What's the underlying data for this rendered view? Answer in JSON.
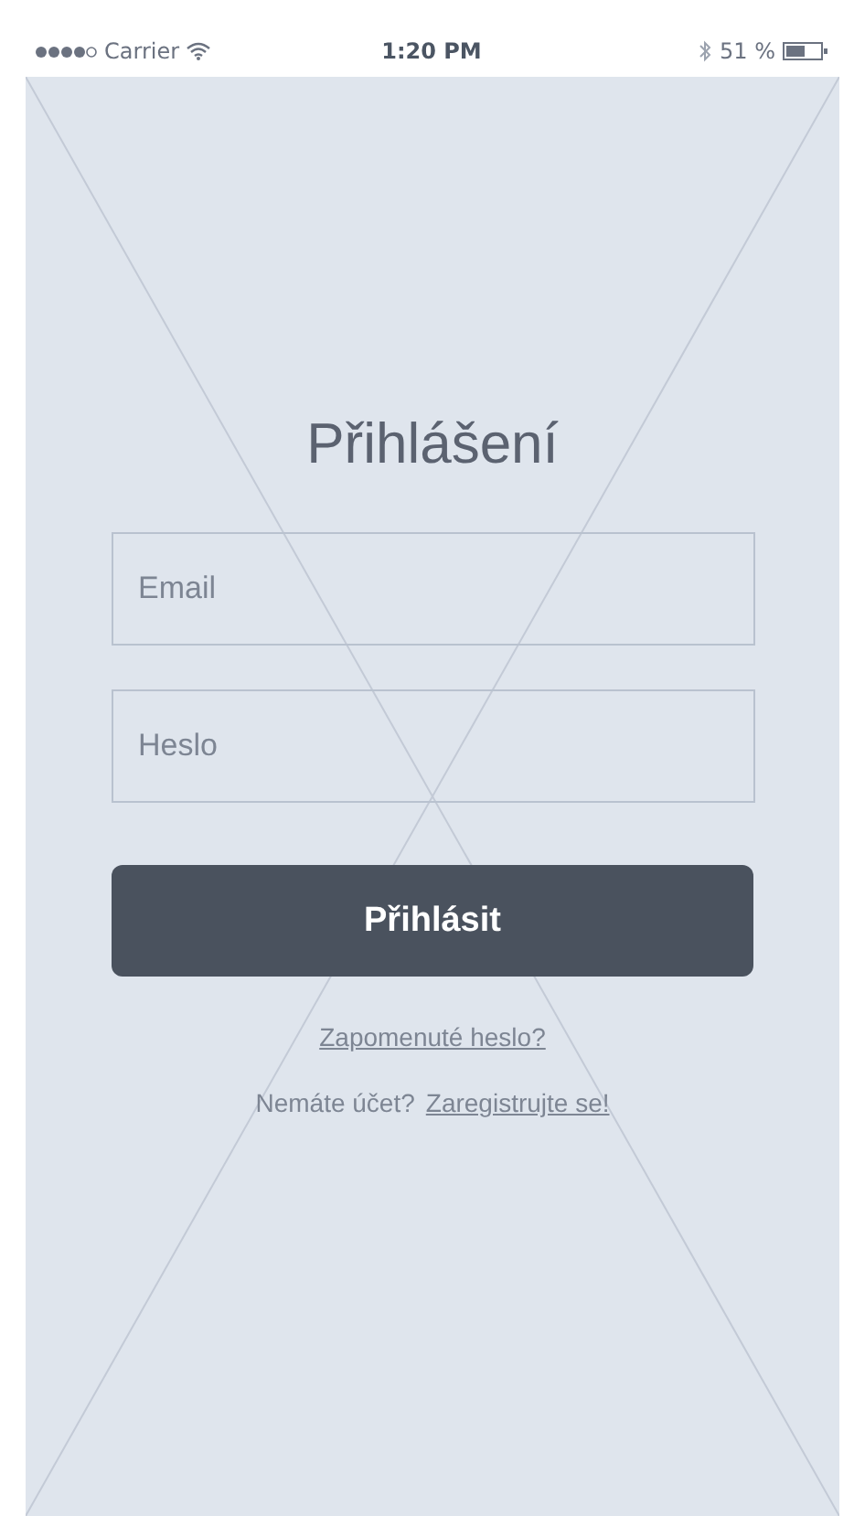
{
  "status_bar": {
    "carrier": "Carrier",
    "time": "1:20 PM",
    "battery": "51 %"
  },
  "title": "Přihlášení",
  "fields": [
    {
      "placeholder": "Email"
    },
    {
      "placeholder": "Heslo"
    }
  ],
  "button": "Přihlásit",
  "forgot_link": "Zapomenuté heslo?",
  "register": {
    "prompt": "Nemáte účet?",
    "link": "Zaregistrujte se!"
  }
}
